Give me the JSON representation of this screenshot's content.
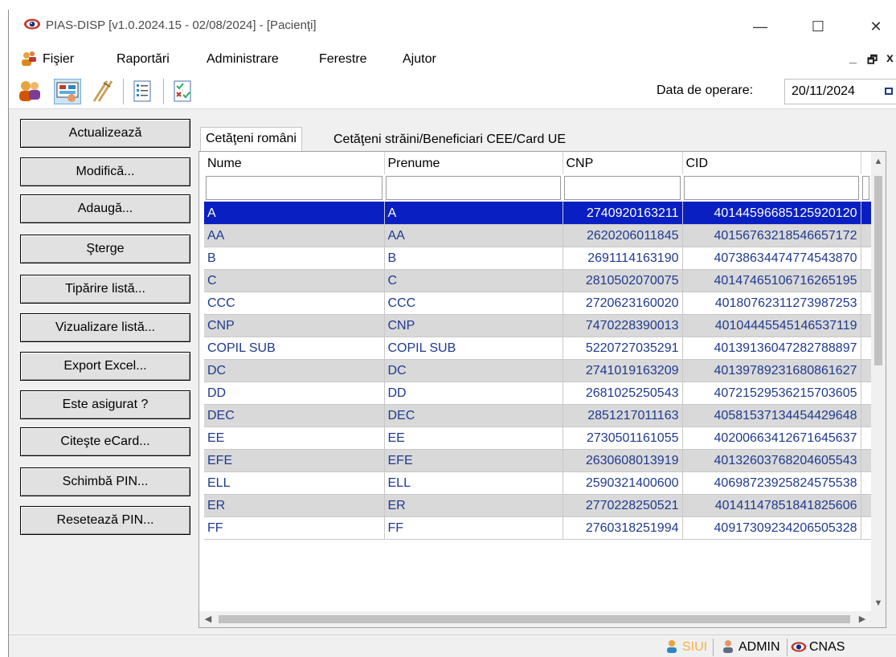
{
  "window": {
    "title": "PIAS-DISP [v1.0.2024.15 - 02/08/2024] - [Pacienţi]",
    "minimize_label": "—",
    "maximize_label": "☐",
    "close_label": "✕"
  },
  "menu": {
    "items": [
      "Fişier",
      "Raportări",
      "Administrare",
      "Ferestre",
      "Ajutor"
    ],
    "mdi_minimize": "_",
    "mdi_restore": "🗗",
    "mdi_close": "x"
  },
  "toolbar": {
    "icons": [
      "patients-icon",
      "diagnosis-icon",
      "crutches-icon",
      "list-icon",
      "checklist-icon"
    ],
    "operation_date_label": "Data de operare:",
    "operation_date_value": "20/11/2024"
  },
  "actions": [
    "Actualizează",
    "Modifică...",
    "Adaugă...",
    "Şterge",
    "Tipărire listă...",
    "Vizualizare listă...",
    "Export Excel...",
    "Este asigurat ?",
    "Citeşte eCard...",
    "Schimbă PIN...",
    "Resetează PIN..."
  ],
  "tabs": [
    "Cetăţeni români",
    "Cetăţeni străini/Beneficiari CEE/Card UE"
  ],
  "table": {
    "columns": [
      "Nume",
      "Prenume",
      "CNP",
      "CID"
    ],
    "selected_index": 0,
    "rows": [
      [
        "A",
        "A",
        "2740920163211",
        "40144596685125920120"
      ],
      [
        "AA",
        "AA",
        "2620206011845",
        "40156763218546657172"
      ],
      [
        "B",
        "B",
        "2691114163190",
        "40738634474774543870"
      ],
      [
        "C",
        "C",
        "2810502070075",
        "40147465106716265195"
      ],
      [
        "CCC",
        "CCC",
        "2720623160020",
        "40180762311273987253"
      ],
      [
        "CNP",
        "CNP",
        "7470228390013",
        "40104445545146537119"
      ],
      [
        "COPIL SUB",
        "COPIL SUB",
        "5220727035291",
        "40139136047282788897"
      ],
      [
        "DC",
        "DC",
        "2741019163209",
        "40139789231680861627"
      ],
      [
        "DD",
        "DD",
        "2681025250543",
        "40721529536215703605"
      ],
      [
        "DEC",
        "DEC",
        "2851217011163",
        "40581537134454429648"
      ],
      [
        "EE",
        "EE",
        "2730501161055",
        "40200663412671645637"
      ],
      [
        "EFE",
        "EFE",
        "2630608013919",
        "40132603768204605543"
      ],
      [
        "ELL",
        "ELL",
        "2590321400600",
        "40698723925824575538"
      ],
      [
        "ER",
        "ER",
        "2770228250521",
        "40141147851841825606"
      ],
      [
        "FF",
        "FF",
        "2760318251994",
        "40917309234206505328"
      ]
    ]
  },
  "status": {
    "siui": "SIUI",
    "user": "ADMIN",
    "org": "CNAS",
    "siui_color": "#f5b041"
  }
}
